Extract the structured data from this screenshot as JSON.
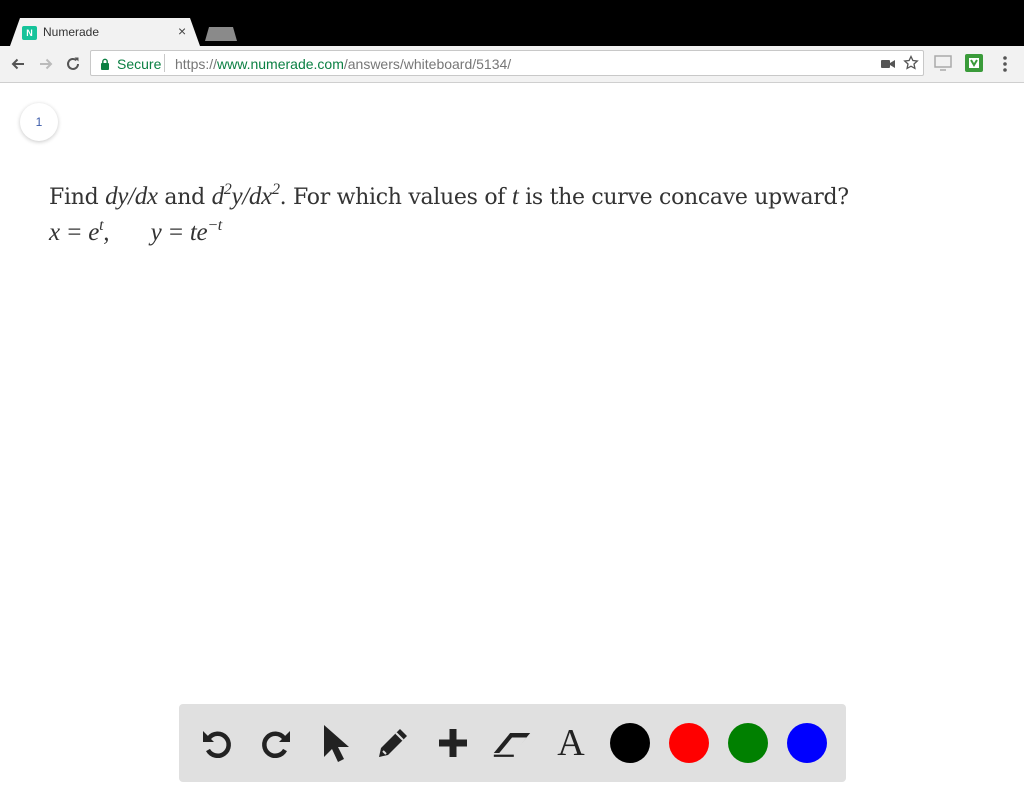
{
  "browser": {
    "tab": {
      "favicon_text": "N",
      "title": "Numerade",
      "close_glyph": "×"
    },
    "omnibox": {
      "secure_label": "Secure",
      "url_scheme": "https://",
      "url_domain": "www.numerade.com",
      "url_path": "/answers/whiteboard/5134/"
    },
    "icons": [
      "back-icon",
      "forward-icon",
      "reload-icon",
      "lock-icon",
      "camera-icon",
      "star-icon",
      "screen-icon",
      "extension-icon",
      "menu-icon"
    ]
  },
  "page": {
    "badge": "1",
    "question": {
      "find": "Find",
      "dy_dx": "dy/dx",
      "and": "and",
      "d": "d",
      "two_a": "2",
      "y_dx": "y/dx",
      "two_b": "2",
      "for_which": ". For which values of",
      "t": "t",
      "rest": "is the curve concave upward?",
      "x_eq": "x = e",
      "x_exp": "t",
      "comma": ",",
      "y_eq": "y = te",
      "y_exp": "−t"
    }
  },
  "draw_toolbar": {
    "tools": [
      "undo-icon",
      "redo-icon",
      "pointer-icon",
      "pencil-icon",
      "plus-icon",
      "eraser-icon",
      "text-icon"
    ],
    "text_tool_glyph": "A",
    "colors": [
      "#000000",
      "#ff0000",
      "#008000",
      "#0000ff"
    ]
  }
}
